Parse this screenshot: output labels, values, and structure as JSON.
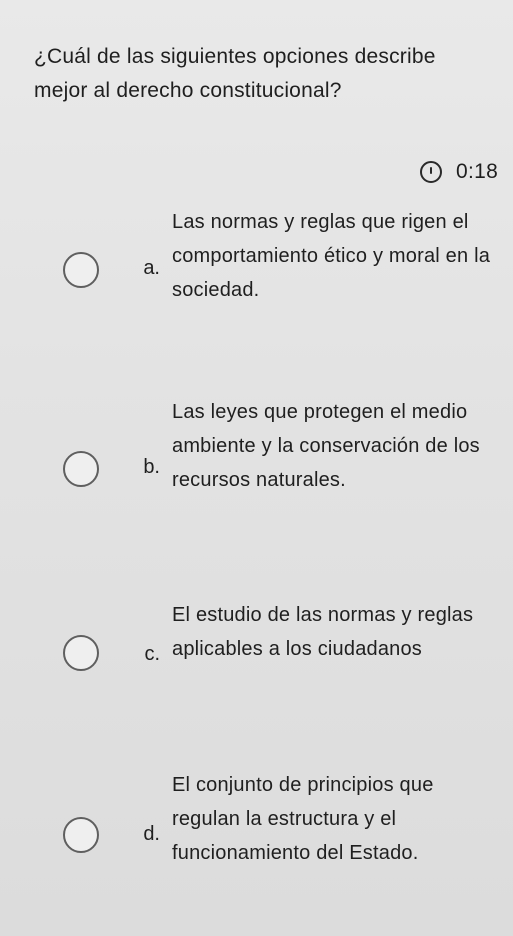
{
  "question": {
    "text": "¿Cuál de las siguientes opciones describe mejor al derecho constitucional?"
  },
  "timer": {
    "value": "0:18",
    "icon": "clock-icon"
  },
  "options": [
    {
      "letter": "a.",
      "text": "Las normas y reglas que rigen el comportamiento ético y moral en la sociedad."
    },
    {
      "letter": "b.",
      "text": "Las leyes que protegen el medio ambiente y la conservación de los recursos naturales."
    },
    {
      "letter": "c.",
      "text": "El estudio de las normas y reglas aplicables a los ciudadanos"
    },
    {
      "letter": "d.",
      "text": "El conjunto de principios que regulan la estructura y el funcionamiento del Estado."
    }
  ]
}
